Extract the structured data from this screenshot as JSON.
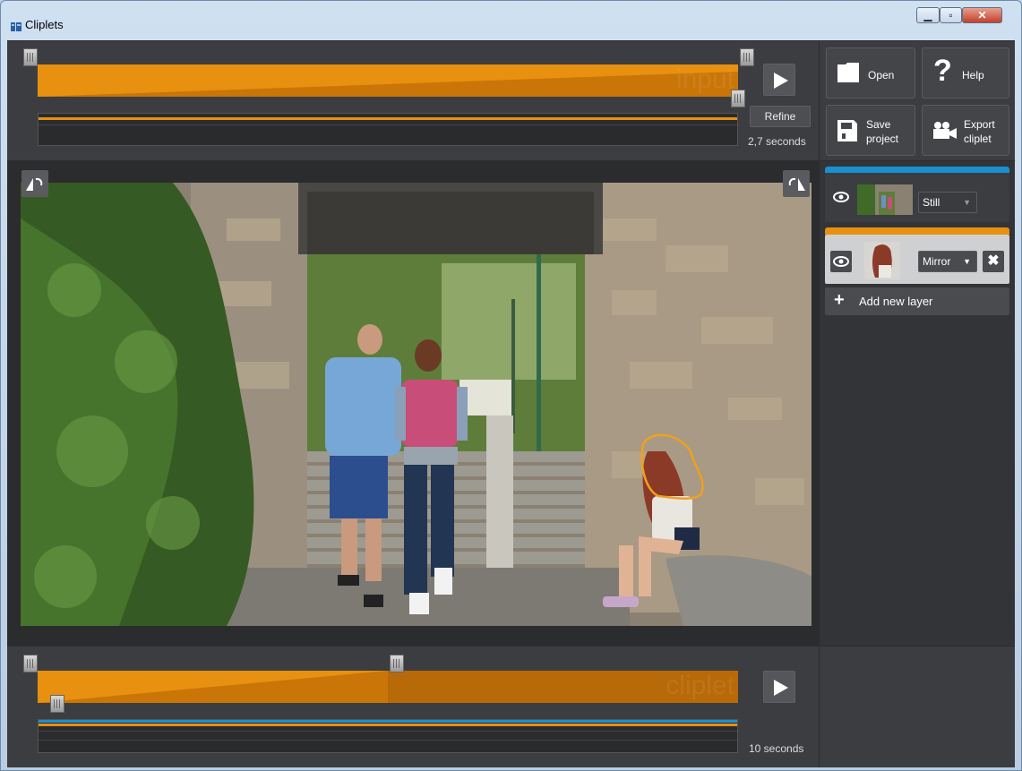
{
  "window": {
    "title": "Cliplets"
  },
  "input_timeline": {
    "watermark": "input",
    "refine_label": "Refine",
    "duration": "2,7 seconds"
  },
  "toolbar": {
    "open_label": "Open",
    "help_label": "Help",
    "save_label_line1": "Save",
    "save_label_line2": "project",
    "export_label_line1": "Export",
    "export_label_line2": "cliplet"
  },
  "layers": [
    {
      "mode": "Still",
      "accent": "#1a8fd1"
    },
    {
      "mode": "Mirror",
      "accent": "#e8900f"
    }
  ],
  "add_layer_label": "Add new layer",
  "output_timeline": {
    "watermark": "cliplet",
    "duration": "10 seconds"
  },
  "colors": {
    "orange": "#e8900f",
    "blue": "#1a8fd1"
  }
}
